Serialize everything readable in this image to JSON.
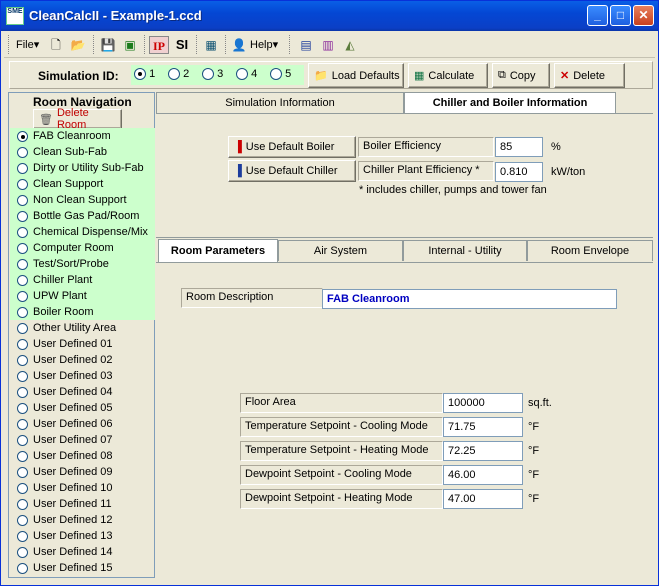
{
  "window": {
    "title": "CleanCalcII - Example-1.ccd",
    "app_icon": "SME"
  },
  "menubar": {
    "file_label": "File",
    "help_label": "Help",
    "ip_label": "IP",
    "si_label": "SI"
  },
  "simulation": {
    "label": "Simulation ID:",
    "ids": [
      "1",
      "2",
      "3",
      "4",
      "5"
    ],
    "selected": "1",
    "load_defaults": "Load Defaults",
    "calculate": "Calculate",
    "copy": "Copy",
    "delete": "Delete"
  },
  "nav": {
    "title": "Room Navigation",
    "delete_room": "Delete Room",
    "selected": "FAB Cleanroom",
    "items": [
      "FAB Cleanroom",
      "Clean Sub-Fab",
      "Dirty or Utility Sub-Fab",
      "Clean Support",
      "Non Clean Support",
      "Bottle Gas Pad/Room",
      "Chemical Dispense/Mix",
      "Computer Room",
      "Test/Sort/Probe",
      "Chiller Plant",
      "UPW Plant",
      "Boiler Room",
      "Other Utility Area",
      "User Defined 01",
      "User Defined 02",
      "User Defined 03",
      "User Defined 04",
      "User Defined 05",
      "User Defined 06",
      "User Defined 07",
      "User Defined 08",
      "User Defined 09",
      "User Defined 10",
      "User Defined 11",
      "User Defined 12",
      "User Defined 13",
      "User Defined 14",
      "User Defined 15"
    ]
  },
  "top_tabs": [
    "Simulation Information",
    "Chiller and Boiler Information"
  ],
  "boiler": {
    "use_default_boiler": "Use Default Boiler",
    "use_default_chiller": "Use Default Chiller",
    "boiler_eff_label": "Boiler Efficiency",
    "boiler_eff_value": "85",
    "boiler_eff_unit": "%",
    "chiller_eff_label": "Chiller Plant Efficiency *",
    "chiller_eff_value": "0.810",
    "chiller_eff_unit": "kW/ton",
    "footnote": "* includes chiller, pumps and tower fan"
  },
  "room_tabs": [
    "Room Parameters",
    "Air System",
    "Internal - Utility",
    "Room Envelope"
  ],
  "room": {
    "desc_label": "Room Description",
    "desc_value": "FAB Cleanroom",
    "fields": [
      {
        "label": "Floor Area",
        "value": "100000",
        "unit": "sq.ft."
      },
      {
        "label": "Temperature Setpoint - Cooling Mode",
        "value": "71.75",
        "unit": "°F"
      },
      {
        "label": "Temperature Setpoint - Heating Mode",
        "value": "72.25",
        "unit": "°F"
      },
      {
        "label": "Dewpoint Setpoint - Cooling Mode",
        "value": "46.00",
        "unit": "°F"
      },
      {
        "label": "Dewpoint Setpoint - Heating Mode",
        "value": "47.00",
        "unit": "°F"
      }
    ]
  },
  "colors": {
    "nav_highlight": "#ccffcc",
    "title_bar": "#0447d4",
    "delete_room_text": "#c00000",
    "desc_text": "#0000c0"
  }
}
